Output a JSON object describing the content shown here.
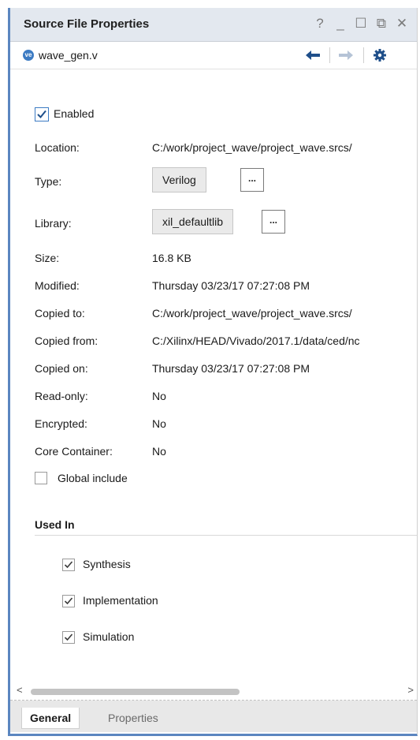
{
  "window": {
    "title": "Source File Properties",
    "controls": [
      "?",
      "_",
      "☐",
      "⧉",
      "✕"
    ]
  },
  "file": {
    "name": "wave_gen.v",
    "icon": "verilog-file-icon",
    "nav": {
      "back_icon": "arrow-left-icon",
      "forward_icon": "arrow-right-icon",
      "settings_icon": "gear-icon"
    }
  },
  "general": {
    "enabled": {
      "label": "Enabled",
      "checked": true
    },
    "properties": [
      {
        "label": "Location:",
        "value": "C:/work/project_wave/project_wave.srcs/"
      },
      {
        "label": "Type:",
        "value": "Verilog"
      },
      {
        "label": "Library:",
        "value": "xil_defaultlib"
      },
      {
        "label": "Size:",
        "value": "16.8 KB"
      },
      {
        "label": "Modified:",
        "value": "Thursday 03/23/17 07:27:08 PM"
      },
      {
        "label": "Copied to:",
        "value": "C:/work/project_wave/project_wave.srcs/"
      },
      {
        "label": "Copied from:",
        "value": "C:/Xilinx/HEAD/Vivado/2017.1/data/ced/nc"
      },
      {
        "label": "Copied on:",
        "value": "Thursday 03/23/17 07:27:08 PM"
      },
      {
        "label": "Read-only:",
        "value": "No"
      },
      {
        "label": "Encrypted:",
        "value": "No"
      },
      {
        "label": "Core Container:",
        "value": "No"
      }
    ],
    "browse_label": "...",
    "global_include": {
      "label": "Global include",
      "checked": false
    }
  },
  "used_in": {
    "title": "Used In",
    "items": [
      {
        "label": "Synthesis",
        "checked": true
      },
      {
        "label": "Implementation",
        "checked": true
      },
      {
        "label": "Simulation",
        "checked": true
      }
    ]
  },
  "scrollbar": {
    "left": "<",
    "right": ">"
  },
  "tabs": [
    {
      "label": "General",
      "active": true
    },
    {
      "label": "Properties",
      "active": false
    }
  ]
}
